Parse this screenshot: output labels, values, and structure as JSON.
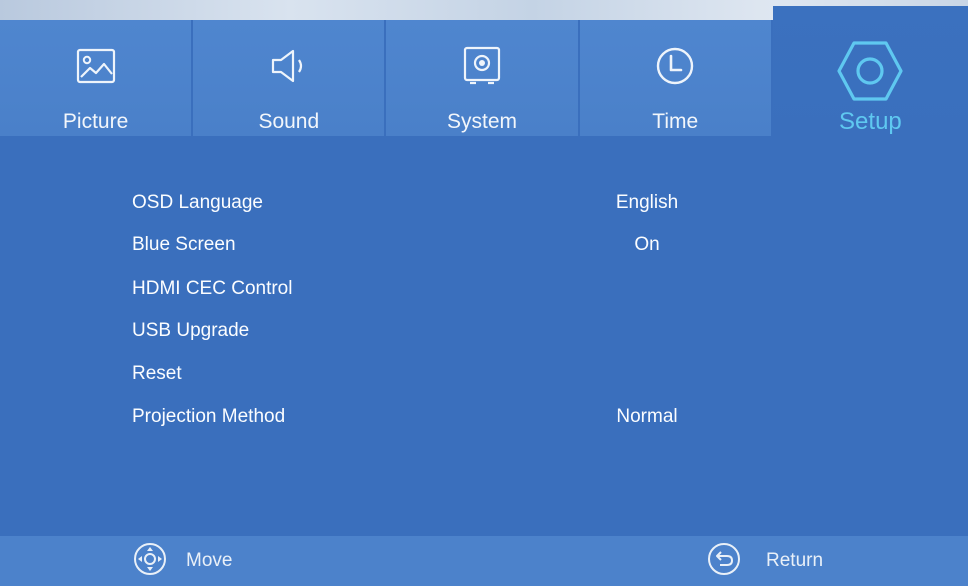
{
  "tabs": [
    {
      "label": "Picture",
      "icon": "picture-icon"
    },
    {
      "label": "Sound",
      "icon": "speaker-icon"
    },
    {
      "label": "System",
      "icon": "system-icon"
    },
    {
      "label": "Time",
      "icon": "clock-icon"
    },
    {
      "label": "Setup",
      "icon": "hexagon-settings-icon",
      "active": true
    }
  ],
  "menu": {
    "items": [
      {
        "label": "OSD Language",
        "value": "English"
      },
      {
        "label": "Blue Screen",
        "value": "On"
      },
      {
        "label": "HDMI CEC Control",
        "value": ""
      },
      {
        "label": "USB Upgrade",
        "value": ""
      },
      {
        "label": "Reset",
        "value": ""
      },
      {
        "label": "Projection Method",
        "value": "Normal"
      }
    ]
  },
  "footer": {
    "move_label": "Move",
    "return_label": "Return"
  },
  "colors": {
    "background": "#3a6fbd",
    "active_tab_text": "#5fc8f0",
    "text": "#ffffff"
  }
}
